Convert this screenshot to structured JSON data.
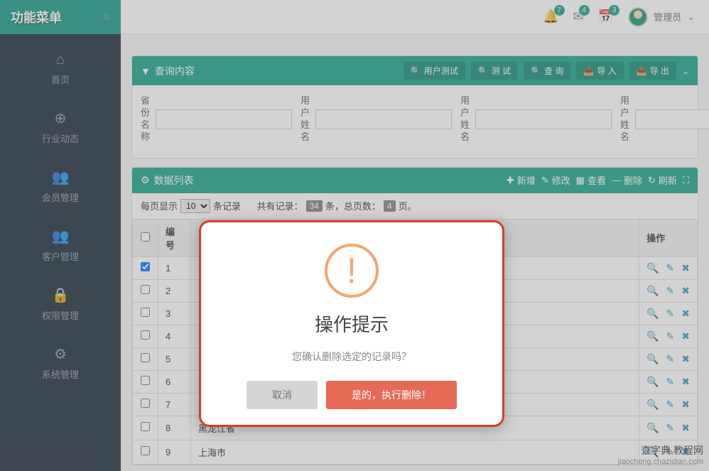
{
  "sidebar": {
    "title": "功能菜单",
    "items": [
      {
        "icon": "home",
        "label": "首页"
      },
      {
        "icon": "globe",
        "label": "行业动态"
      },
      {
        "icon": "users",
        "label": "会员管理"
      },
      {
        "icon": "users",
        "label": "客户管理"
      },
      {
        "icon": "lock",
        "label": "权限管理"
      },
      {
        "icon": "gear",
        "label": "系统管理"
      }
    ]
  },
  "header": {
    "notifications": [
      {
        "icon": "bell",
        "count": "7"
      },
      {
        "icon": "mail",
        "count": "4"
      },
      {
        "icon": "calendar",
        "count": "3"
      }
    ],
    "user": {
      "name": "管理员"
    }
  },
  "searchPanel": {
    "title": "查询内容",
    "buttons": {
      "userTest": "用户测试",
      "test": "测 试",
      "query": "查 询",
      "import": "导 入",
      "export": "导 出"
    },
    "fields": [
      {
        "label": "省份名称"
      },
      {
        "label": "用户姓名"
      },
      {
        "label": "用户姓名"
      },
      {
        "label": "用户姓名"
      }
    ]
  },
  "dataPanel": {
    "title": "数据列表",
    "tools": {
      "add": "新增",
      "edit": "修改",
      "view": "查看",
      "delete": "删除",
      "refresh": "刷新"
    },
    "pagination": {
      "perPageLabel": "每页显示",
      "perPageValue": "10",
      "recordsSuffix": "条记录",
      "totalPrefix": "共有记录：",
      "totalCount": "34",
      "totalSuffix": "条，总页数：",
      "pageCount": "4",
      "pageSuffix": "页。"
    },
    "columns": {
      "num": "编号",
      "op": "操作"
    },
    "rows": [
      {
        "num": "1",
        "checked": true,
        "province": ""
      },
      {
        "num": "2",
        "checked": false,
        "province": ""
      },
      {
        "num": "3",
        "checked": false,
        "province": ""
      },
      {
        "num": "4",
        "checked": false,
        "province": ""
      },
      {
        "num": "5",
        "checked": false,
        "province": ""
      },
      {
        "num": "6",
        "checked": false,
        "province": ""
      },
      {
        "num": "7",
        "checked": false,
        "province": ""
      },
      {
        "num": "8",
        "checked": false,
        "province": "黑龙江省"
      },
      {
        "num": "9",
        "checked": false,
        "province": "上海市"
      }
    ]
  },
  "modal": {
    "title": "操作提示",
    "message": "您确认删除选定的记录吗？",
    "cancel": "取消",
    "confirm": "是的，执行删除！"
  },
  "watermark": {
    "line1": "查字典 教程网",
    "line2": "jiaocheng.chazidian.com"
  }
}
